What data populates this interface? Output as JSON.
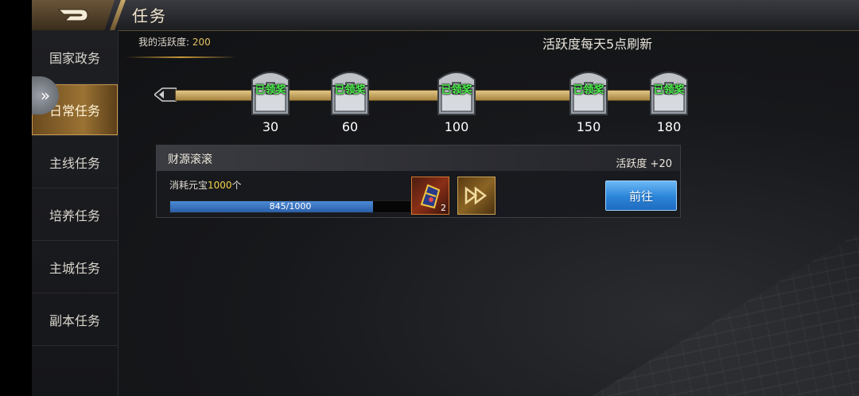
{
  "header": {
    "title": "任务"
  },
  "sidebar": {
    "items": [
      {
        "label": "国家政务",
        "active": false
      },
      {
        "label": "日常任务",
        "active": true
      },
      {
        "label": "主线任务",
        "active": false
      },
      {
        "label": "培养任务",
        "active": false
      },
      {
        "label": "主城任务",
        "active": false
      },
      {
        "label": "副本任务",
        "active": false
      }
    ]
  },
  "activity": {
    "label": "我的活跃度:",
    "value": "200",
    "refresh_note": "活跃度每天5点刷新",
    "milestones": [
      {
        "value": "30",
        "status": "已领奖"
      },
      {
        "value": "60",
        "status": "已领奖"
      },
      {
        "value": "100",
        "status": "已领奖"
      },
      {
        "value": "150",
        "status": "已领奖"
      },
      {
        "value": "180",
        "status": "已领奖"
      }
    ]
  },
  "task": {
    "name": "财源滚滚",
    "reward": "活跃度 +20",
    "desc_prefix": "消耗元宝",
    "desc_amount": "1000",
    "desc_suffix": "个",
    "progress_text": "845/1000",
    "progress_fraction": 0.845,
    "item_count": "2",
    "go_label": "前往"
  },
  "colors": {
    "accent_gold": "#c9a96a",
    "claimed_green": "#4cf04c",
    "progress_blue": "#2b5ea8",
    "button_blue": "#2a84d8"
  }
}
